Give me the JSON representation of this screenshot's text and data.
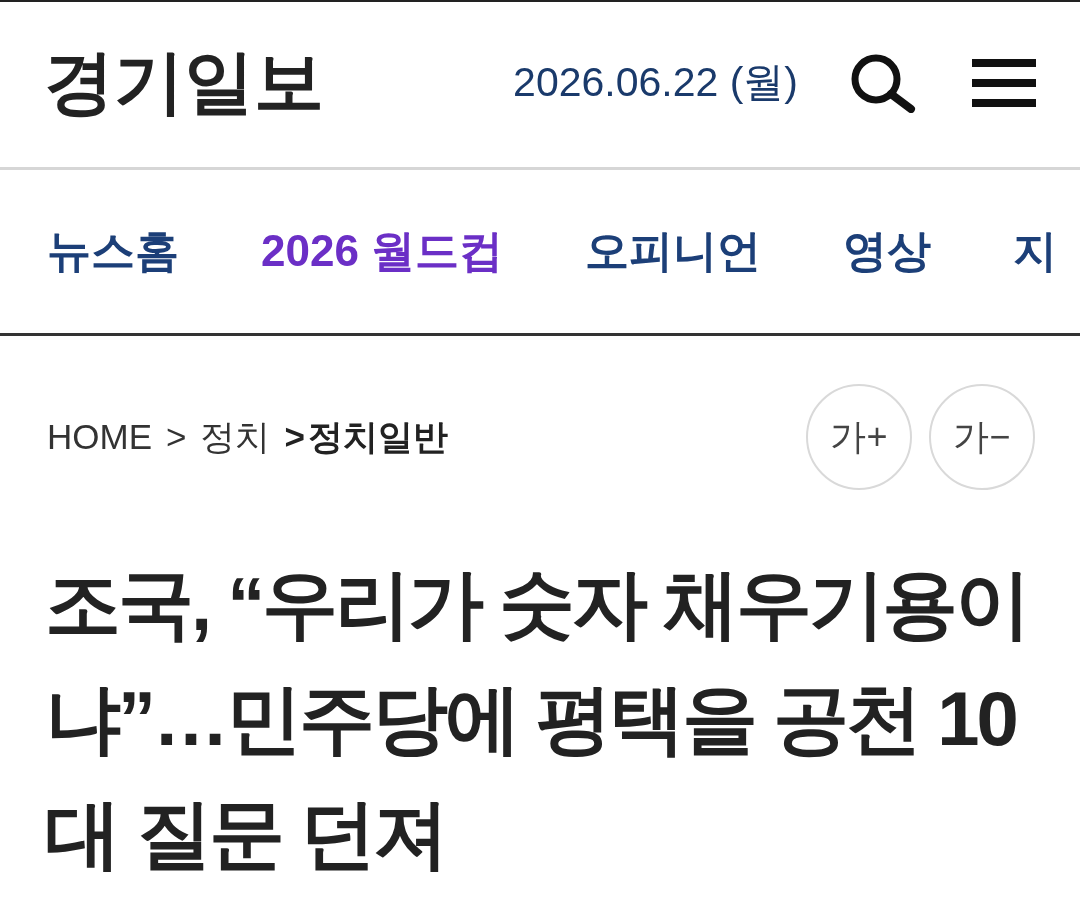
{
  "header": {
    "logo": "경기일보",
    "date": "2026.06.22 (월)"
  },
  "nav": {
    "items": [
      {
        "label": "뉴스홈",
        "color": "#1c3f78"
      },
      {
        "label": "2026 월드컵",
        "color": "#6b2fc6"
      },
      {
        "label": "오피니언",
        "color": "#1c3f78"
      },
      {
        "label": "영상",
        "color": "#1c3f78"
      },
      {
        "label": "지",
        "color": "#1c3f78"
      }
    ]
  },
  "breadcrumb": [
    {
      "label": "HOME",
      "current": false
    },
    {
      "separator": ">",
      "label": "정치",
      "current": false
    },
    {
      "separator": ">",
      "label": "정치일반",
      "current": true
    }
  ],
  "font_size_buttons": [
    {
      "label": "가+"
    },
    {
      "label": "가−"
    }
  ],
  "article": {
    "headline": "조국, “우리가 숫자 채우기용이냐”…민주당에 평택을 공천 10대 질문 던져"
  }
}
